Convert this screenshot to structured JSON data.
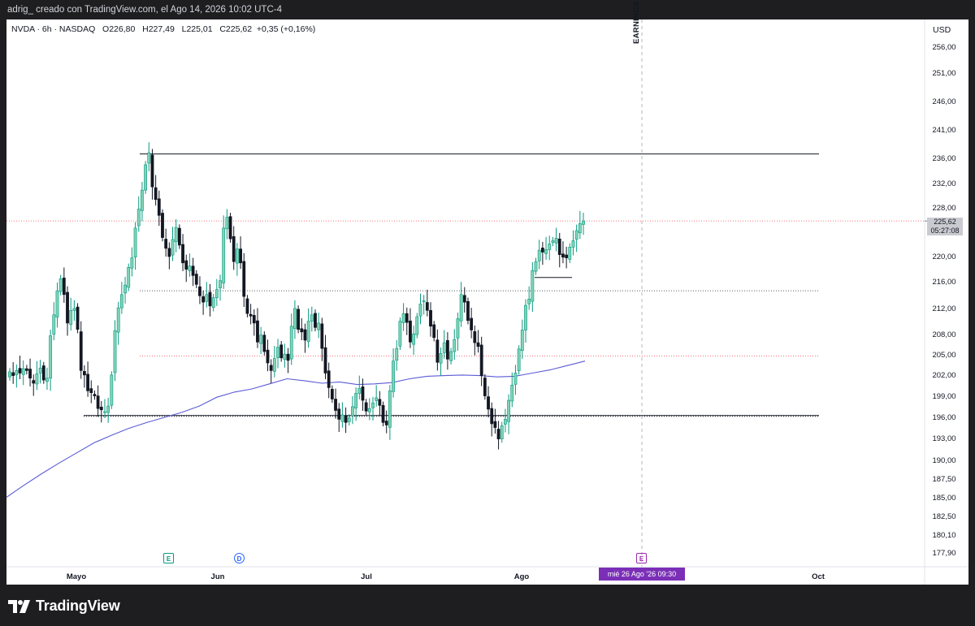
{
  "header": {
    "author_line": "adrig_ creado con TradingView.com, el Ago 14, 2026 10:02 UTC-4",
    "symbol_line": "NVDA · 6h · NASDAQ",
    "ohlc": {
      "o_label": "O",
      "o": "226,80",
      "h_label": "H",
      "h": "227,49",
      "l_label": "L",
      "l": "225,01",
      "c_label": "C",
      "c": "225,62",
      "change": "+0,35 (+0,16%)"
    }
  },
  "currency": "USD",
  "price_tag": {
    "price": "225,62",
    "countdown": "05:27:08"
  },
  "earnings_label": "EARNINGS",
  "date_tag": "mié 26 Ago '26   09:30",
  "events": [
    {
      "letter": "E",
      "color": "#089981"
    },
    {
      "letter": "D",
      "color": "#2962ff"
    },
    {
      "letter": "E",
      "color": "#9c27b0"
    }
  ],
  "footer": {
    "brand": "TradingView"
  },
  "colors": {
    "up": "#089981",
    "up_fill": "#7fd3b5",
    "down": "#131722",
    "ma": "#5b5bd6",
    "earnings": "#9c27b0"
  },
  "chart_data": {
    "type": "candlestick",
    "symbol": "NVDA",
    "interval": "6h",
    "exchange": "NASDAQ",
    "y_ticks": [
      "256,00",
      "251,00",
      "246,00",
      "241,00",
      "236,00",
      "232,00",
      "228,00",
      "220,00",
      "216,00",
      "212,00",
      "208,00",
      "205,00",
      "202,00",
      "199,00",
      "196,00",
      "193,00",
      "190,00",
      "187,50",
      "185,00",
      "182,50",
      "180,10",
      "177,90"
    ],
    "x_ticks": [
      "Mayo",
      "Jun",
      "Jul",
      "Ago",
      "Oct"
    ],
    "last_price": 225.62,
    "horizontal_lines": [
      {
        "price": 236.2,
        "style": "solid",
        "color": "#131722"
      },
      {
        "price": 225.62,
        "style": "dotted",
        "color": "#f23645"
      },
      {
        "price": 214.6,
        "style": "dotted",
        "color": "#131722"
      },
      {
        "price": 204.3,
        "style": "dotted",
        "color": "#f23645"
      },
      {
        "price": 194.9,
        "style": "solid",
        "color": "#131722"
      },
      {
        "price": 216.7,
        "style": "solid",
        "color": "#131722"
      }
    ],
    "closes": [
      201.8,
      201.2,
      202.0,
      201.6,
      202.3,
      202.0,
      200.8,
      200.0,
      201.5,
      202.4,
      200.5,
      200.8,
      207.5,
      210.8,
      214.6,
      216.5,
      214.0,
      209.5,
      211.5,
      211.8,
      208.5,
      202.0,
      201.3,
      198.8,
      198.5,
      198.0,
      196.0,
      195.8,
      195.5,
      196.4,
      201.3,
      208.3,
      211.9,
      214.0,
      215.5,
      218.3,
      219.8,
      224.5,
      227.5,
      230.5,
      234.5,
      236.4,
      231.0,
      229.0,
      226.5,
      223.0,
      221.3,
      220.0,
      222.7,
      224.6,
      221.8,
      219.0,
      218.0,
      218.5,
      217.0,
      215.6,
      213.8,
      212.8,
      214.0,
      212.2,
      213.5,
      214.8,
      216.2,
      224.5,
      226.2,
      222.8,
      219.2,
      221.2,
      219.0,
      213.7,
      211.0,
      210.6,
      209.5,
      206.5,
      207.6,
      205.0,
      203.2,
      202.0,
      203.9,
      205.7,
      204.0,
      204.6,
      203.6,
      209.0,
      211.8,
      208.5,
      208.1,
      206.8,
      209.8,
      210.8,
      208.8,
      209.5,
      205.5,
      201.6,
      199.3,
      197.5,
      195.7,
      194.3,
      195.0,
      193.8,
      194.5,
      196.3,
      198.4,
      199.2,
      197.3,
      195.6,
      196.0,
      196.9,
      197.7,
      196.5,
      193.8,
      193.4,
      198.8,
      203.5,
      205.5,
      209.8,
      211.0,
      209.6,
      206.5,
      207.8,
      210.5,
      212.5,
      213.0,
      211.5,
      209.0,
      207.2,
      203.3,
      204.7,
      206.4,
      203.8,
      205.0,
      206.9,
      210.2,
      214.0,
      212.8,
      209.9,
      208.4,
      206.4,
      205.8,
      201.2,
      198.0,
      195.9,
      193.6,
      193.0,
      191.2,
      193.3,
      194.3,
      197.3,
      199.7,
      201.6,
      205.4,
      208.4,
      212.3,
      213.3,
      217.8,
      219.2,
      221.0,
      220.7,
      221.1,
      222.0,
      222.5,
      222.9,
      220.3,
      219.9,
      219.8,
      221.5,
      222.5,
      224.1,
      225.2,
      225.62
    ],
    "ma200": [
      182.0,
      183.9,
      185.7,
      187.4,
      189.0,
      190.6,
      191.8,
      192.9,
      193.8,
      194.6,
      195.4,
      196.4,
      197.8,
      198.6,
      199.1,
      199.9,
      200.7,
      200.4,
      200.0,
      200.2,
      199.8,
      199.9,
      200.1,
      200.7,
      201.1,
      201.2,
      201.3,
      201.2,
      201.0,
      201.1,
      201.6,
      202.1,
      202.8,
      203.5
    ]
  }
}
